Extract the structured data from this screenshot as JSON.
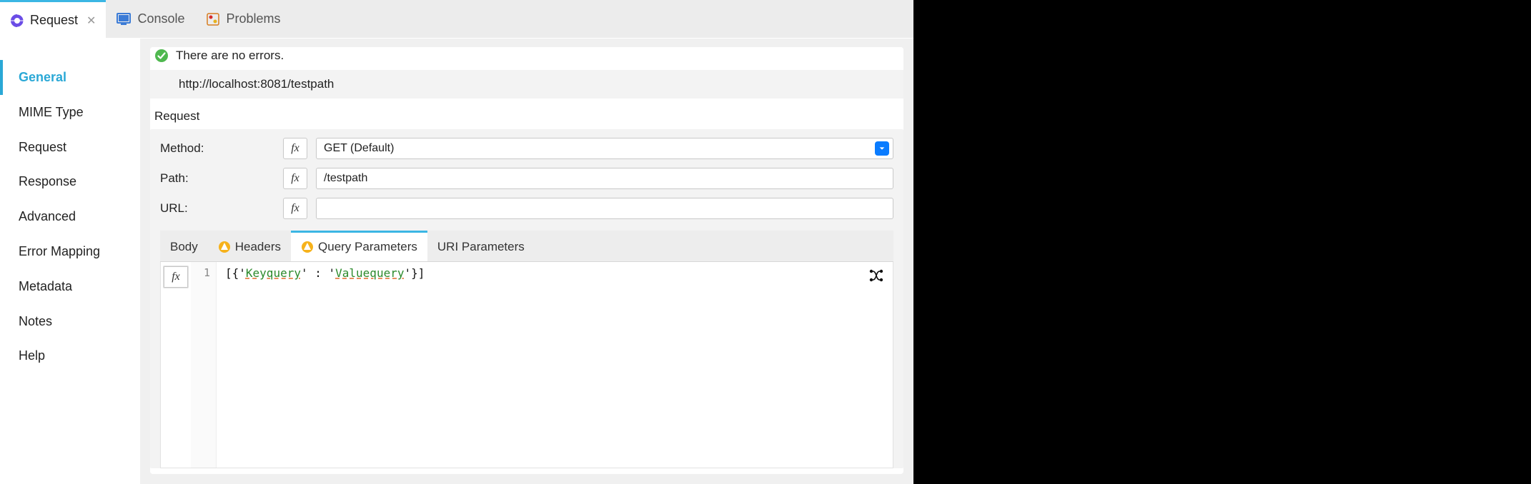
{
  "top_tabs": {
    "request": "Request",
    "console": "Console",
    "problems": "Problems"
  },
  "sidebar": {
    "items": [
      "General",
      "MIME Type",
      "Request",
      "Response",
      "Advanced",
      "Error Mapping",
      "Metadata",
      "Notes",
      "Help"
    ],
    "active_index": 0
  },
  "status": {
    "text": "There are no errors."
  },
  "url_display": "http://localhost:8081/testpath",
  "request_section_label": "Request",
  "form": {
    "method_label": "Method:",
    "method_value": "GET (Default)",
    "path_label": "Path:",
    "path_value": "/testpath",
    "url_label": "URL:",
    "url_value": ""
  },
  "inner_tabs": {
    "body": "Body",
    "headers": "Headers",
    "query_params": "Query Parameters",
    "uri_params": "URI Parameters",
    "active": "query_params"
  },
  "editor": {
    "line_number": "1",
    "prefix": "[{'",
    "key": "Keyquery",
    "mid": "' : '",
    "value": "Valuequery",
    "suffix": "'}]"
  },
  "fx_label": "fx"
}
